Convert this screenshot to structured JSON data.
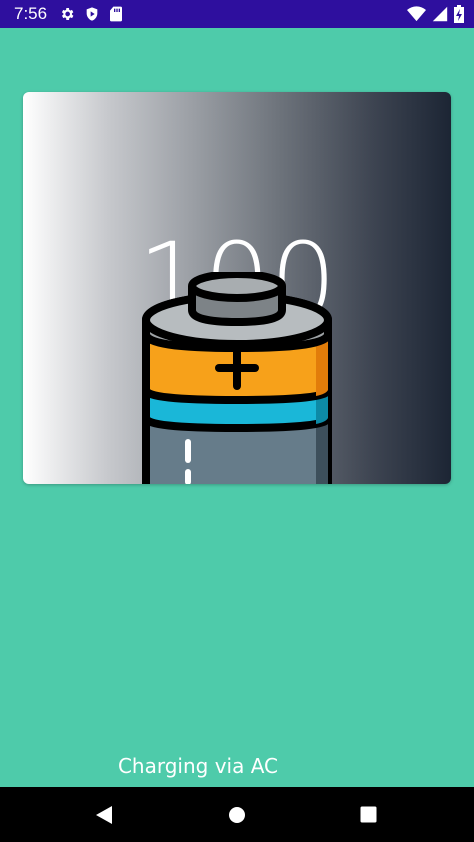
{
  "status_bar": {
    "time": "7:56",
    "icons_left": [
      "settings-icon",
      "play-protect-icon",
      "sd-card-icon"
    ],
    "icons_right": [
      "wifi-icon",
      "signal-icon",
      "battery-charging-icon"
    ]
  },
  "battery_card": {
    "level": "100",
    "image": "battery-icon"
  },
  "charging_status": "Charging via AC",
  "nav_bar": {
    "buttons": [
      "back-button",
      "home-button",
      "recents-button"
    ]
  },
  "colors": {
    "background": "#4ecbaa",
    "status_bar": "#2e0f9e",
    "battery_orange": "#f7a11a",
    "battery_cyan": "#1ab7d8"
  }
}
